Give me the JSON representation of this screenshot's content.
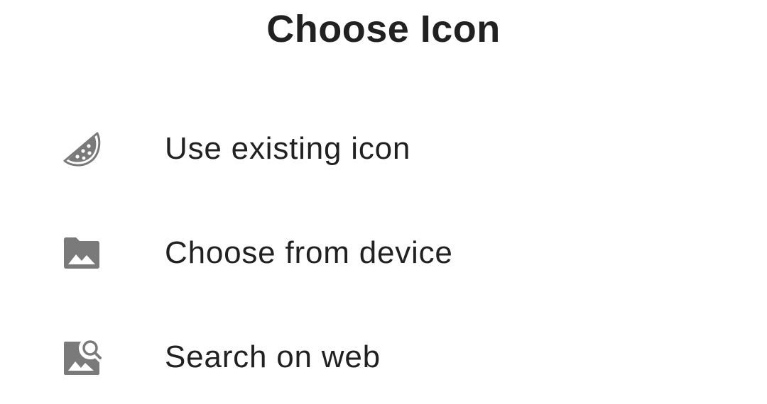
{
  "dialog": {
    "title": "Choose Icon",
    "options": [
      {
        "label": "Use existing icon",
        "icon": "watermelon-icon"
      },
      {
        "label": "Choose from device",
        "icon": "image-folder-icon"
      },
      {
        "label": "Search on web",
        "icon": "image-search-icon"
      }
    ]
  },
  "colors": {
    "icon": "#7a7a7a",
    "text": "#212121",
    "background": "#ffffff"
  }
}
